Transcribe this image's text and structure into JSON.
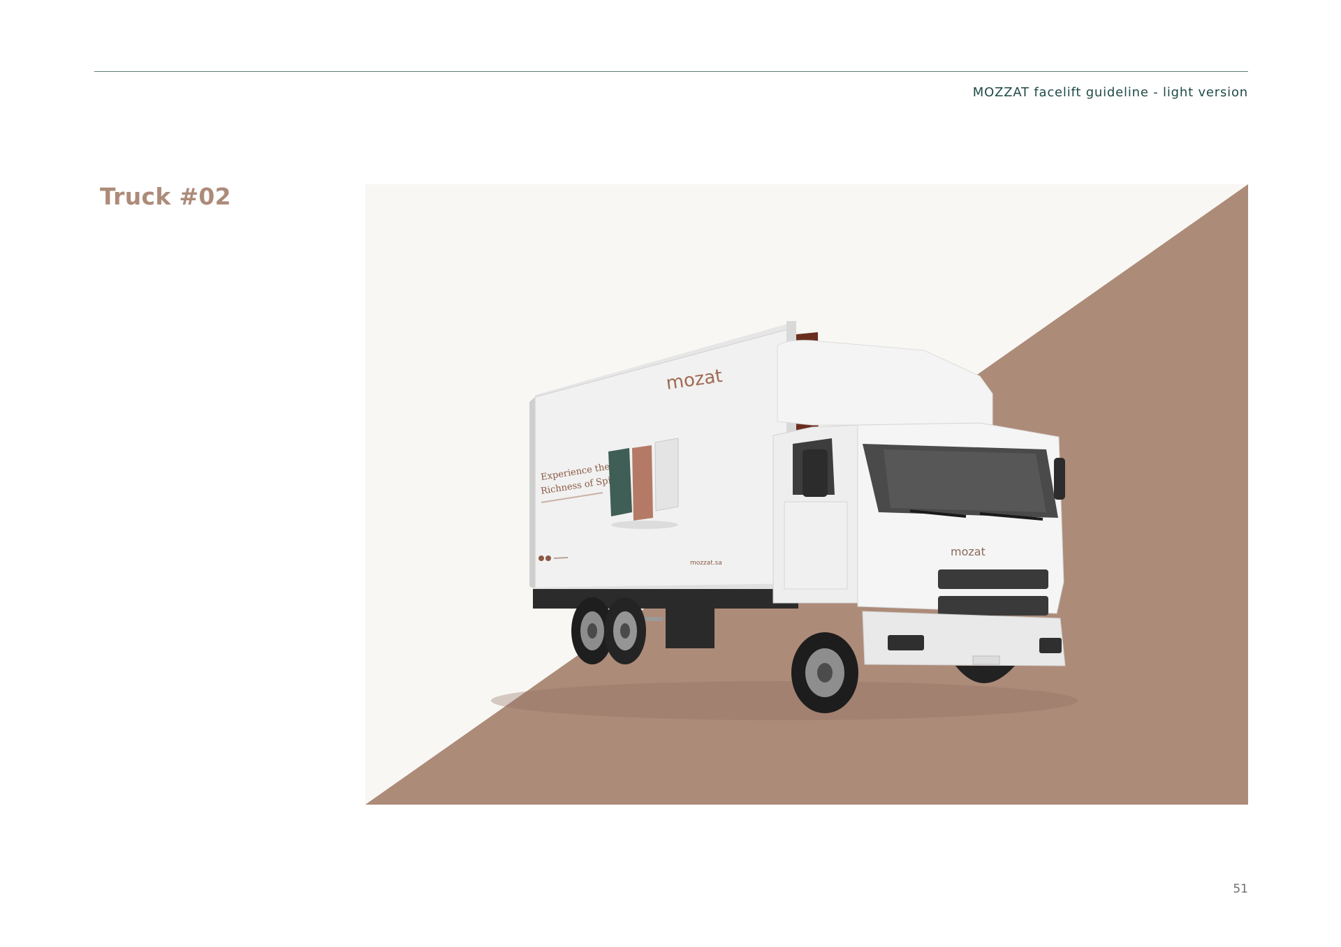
{
  "header": {
    "document_title": "MOZZAT facelift guideline - light version"
  },
  "section": {
    "title": "Truck #02"
  },
  "mockup": {
    "brand_logo": "mozat",
    "ad_headline_line1": "Experience the",
    "ad_headline_line2": "Richness of Spices",
    "website": "mozzat.sa",
    "grille_logo": "mozat",
    "colors": {
      "background": "#f9f7f4",
      "accent_brown": "#ad8b79",
      "box_stripe": "#6a2e1f",
      "pouch_green": "#3f5e55",
      "pouch_terracotta": "#b57a66",
      "pouch_white": "#e9e9e9"
    }
  },
  "footer": {
    "page_number": "51"
  }
}
